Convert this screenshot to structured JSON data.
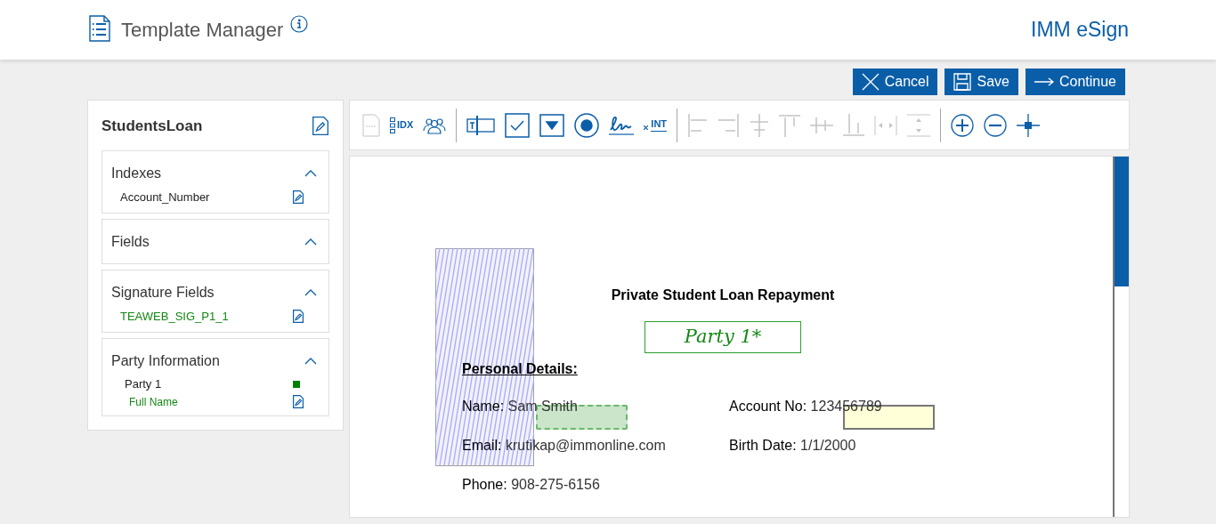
{
  "header": {
    "title": "Template Manager",
    "brand": "IMM eSign"
  },
  "actions": [
    {
      "kind": "cancel",
      "label": "Cancel"
    },
    {
      "kind": "save",
      "label": "Save"
    },
    {
      "kind": "continue",
      "label": "Continue"
    }
  ],
  "sidebar": {
    "title": "StudentsLoan",
    "sections": [
      {
        "title": "Indexes",
        "expanded": true,
        "items": [
          {
            "kind": "index",
            "label": "Account_Number"
          }
        ]
      },
      {
        "title": "Fields",
        "expanded": true
      },
      {
        "title": "Signature Fields",
        "expanded": true,
        "items": [
          {
            "kind": "signature",
            "label": "TEAWEB_SIG_P1_1"
          }
        ]
      },
      {
        "title": "Party Information",
        "expanded": true,
        "items": [
          {
            "kind": "party",
            "label": "Party 1",
            "color": "#008000"
          },
          {
            "kind": "field",
            "label": "Full Name"
          }
        ]
      }
    ]
  },
  "toolbar": [
    {
      "kind": "doc",
      "disabled": true
    },
    {
      "kind": "index",
      "label": "IDX",
      "disabled": false
    },
    {
      "kind": "parties",
      "disabled": false
    },
    {
      "kind": "sep"
    },
    {
      "kind": "textfield",
      "disabled": false
    },
    {
      "kind": "checkbox",
      "disabled": false
    },
    {
      "kind": "dropdown",
      "disabled": false
    },
    {
      "kind": "radio",
      "disabled": false
    },
    {
      "kind": "signature",
      "disabled": false
    },
    {
      "kind": "initials",
      "label": "INT",
      "disabled": false
    },
    {
      "kind": "sep"
    },
    {
      "kind": "align-left",
      "disabled": true
    },
    {
      "kind": "align-right",
      "disabled": true
    },
    {
      "kind": "align-center",
      "disabled": true
    },
    {
      "kind": "align-top",
      "disabled": true
    },
    {
      "kind": "align-middle",
      "disabled": true
    },
    {
      "kind": "align-bottom",
      "disabled": true
    },
    {
      "kind": "space-horizontal",
      "disabled": true
    },
    {
      "kind": "space-vertical",
      "disabled": true
    },
    {
      "kind": "sep"
    },
    {
      "kind": "zoom-in",
      "disabled": false
    },
    {
      "kind": "zoom-out",
      "disabled": false
    },
    {
      "kind": "move",
      "disabled": false
    }
  ],
  "document": {
    "title": "Private Student Loan Repayment",
    "party_field": "Party 1*",
    "section": "Personal Details:",
    "rows": [
      [
        {
          "label": "Name:",
          "value": "Sam Smith"
        },
        {
          "label": "Account No:",
          "value": "123456789"
        }
      ],
      [
        {
          "label": "Email:",
          "value": "krutikap@immonline.com"
        },
        {
          "label": "Birth Date:",
          "value": "1/1/2000"
        }
      ],
      [
        {
          "label": "Phone:",
          "value": "908-275-6156"
        }
      ]
    ]
  }
}
